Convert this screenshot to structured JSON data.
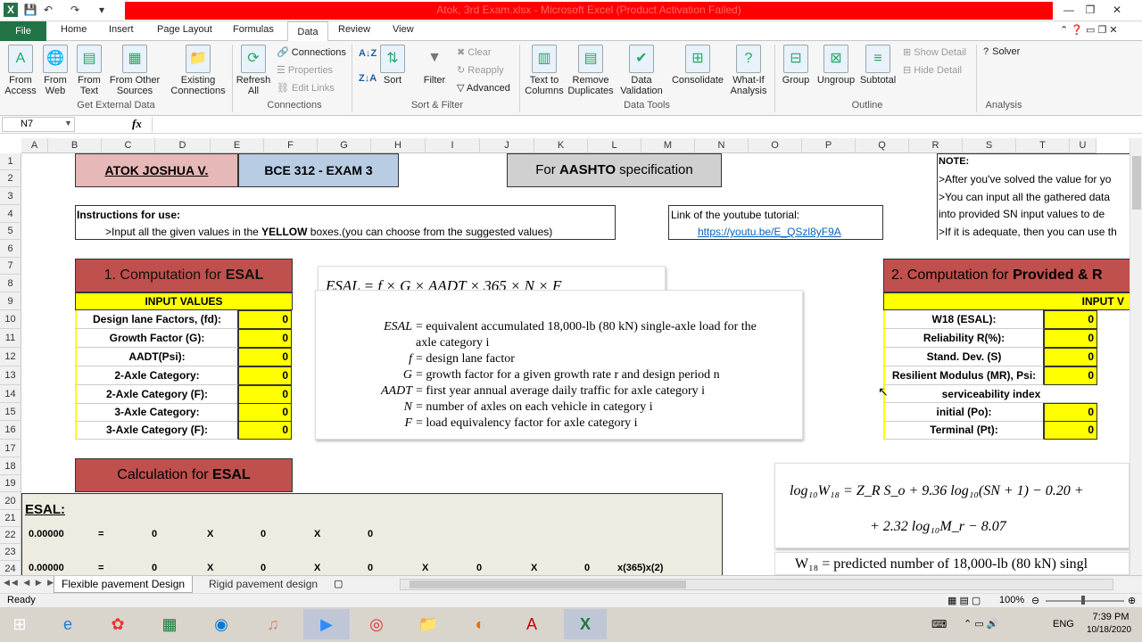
{
  "window": {
    "title": "Atok, 3rd Exam.xlsx - Microsoft Excel (Product Activation Failed)"
  },
  "menu": {
    "file": "File",
    "tabs": [
      "Home",
      "Insert",
      "Page Layout",
      "Formulas",
      "Data",
      "Review",
      "View"
    ]
  },
  "ribbon": {
    "get_external": {
      "label": "Get External Data",
      "from_access": "From Access",
      "from_web": "From Web",
      "from_text": "From Text",
      "from_other": "From Other Sources",
      "existing": "Existing Connections"
    },
    "connections": {
      "label": "Connections",
      "refresh": "Refresh All",
      "conn": "Connections",
      "props": "Properties",
      "edit": "Edit Links"
    },
    "sort_filter": {
      "label": "Sort & Filter",
      "sort": "Sort",
      "filter": "Filter",
      "clear": "Clear",
      "reapply": "Reapply",
      "advanced": "Advanced",
      "az": "A↓Z",
      "za": "Z↓A"
    },
    "data_tools": {
      "label": "Data Tools",
      "text_cols": "Text to Columns",
      "remove_dup": "Remove Duplicates",
      "validation": "Data Validation",
      "consolidate": "Consolidate",
      "whatif": "What-If Analysis"
    },
    "outline": {
      "label": "Outline",
      "group": "Group",
      "ungroup": "Ungroup",
      "subtotal": "Subtotal",
      "show_detail": "Show Detail",
      "hide_detail": "Hide Detail"
    },
    "analysis": {
      "label": "Analysis",
      "solver": "Solver"
    }
  },
  "formulabar": {
    "namebox": "N7",
    "fx": "fx",
    "value": ""
  },
  "columns": [
    "A",
    "B",
    "C",
    "D",
    "E",
    "F",
    "G",
    "H",
    "I",
    "J",
    "K",
    "L",
    "M",
    "N",
    "O",
    "P",
    "Q",
    "R",
    "S",
    "T",
    "U"
  ],
  "rows": [
    "1",
    "2",
    "3",
    "4",
    "5",
    "6",
    "7",
    "8",
    "9",
    "10",
    "11",
    "12",
    "13",
    "14",
    "15",
    "16",
    "17",
    "18",
    "19",
    "20",
    "21",
    "22",
    "23",
    "24"
  ],
  "sheet": {
    "author": "ATOK JOSHUA V.",
    "course": "BCE 312 - EXAM 3",
    "spec_pre": "For ",
    "spec_bold": "AASHTO",
    "spec_post": " specification",
    "instr_title": "Instructions for use:",
    "instr_pre": ">Input all the given values in the ",
    "instr_bold": "YELLOW",
    "instr_post": " boxes.(you can choose from the suggested values)",
    "yt_label": "Link of the youtube tutorial:",
    "yt_link": "https://youtu.be/E_QSzl8yF9A",
    "note_title": "NOTE:",
    "note_lines": [
      ">After you've solved the value for yo",
      ">You can input all the gathered data",
      " into provided SN input values to de",
      ">If it is adequate, then you can use th"
    ],
    "esal_title_pre": "1. Computation for ",
    "esal_title_bold": "ESAL",
    "input_values": "INPUT VALUES",
    "esal_inputs": [
      {
        "label": "Design lane Factors, (fd):",
        "value": "0"
      },
      {
        "label": "Growth Factor (G):",
        "value": "0"
      },
      {
        "label": "AADT(Psi):",
        "value": "0"
      },
      {
        "label": "2-Axle Category:",
        "value": "0"
      },
      {
        "label": "2-Axle Category (F):",
        "value": "0"
      },
      {
        "label": "3-Axle Category:",
        "value": "0"
      },
      {
        "label": "3-Axle Category (F):",
        "value": "0"
      }
    ],
    "esal_formula": "ESAL = f × G × AADT × 365 × N × F",
    "defs": [
      {
        "sym": "ESAL",
        "eq": "= equivalent accumulated 18,000-lb (80 kN) single-axle load for the"
      },
      {
        "sym": "",
        "eq": "axle category i"
      },
      {
        "sym": "f",
        "eq": "= design lane factor"
      },
      {
        "sym": "G",
        "eq": "= growth factor for a given growth rate r and design period n"
      },
      {
        "sym": "AADT",
        "eq": "= first year annual average daily traffic for axle category i"
      },
      {
        "sym": "N",
        "eq": "= number of axles on each vehicle in category i"
      },
      {
        "sym": "F",
        "eq": "= load equivalency factor for axle category i"
      }
    ],
    "sn_title_pre": "2. Computation for ",
    "sn_title_bold": "Provided & R",
    "sn_input": "INPUT V",
    "sn_inputs": [
      {
        "label": "W18 (ESAL):",
        "value": "0"
      },
      {
        "label": "Reliability R(%):",
        "value": "0"
      },
      {
        "label": "Stand. Dev. (S)",
        "value": "0"
      },
      {
        "label": "Resilient Modulus (MR), Psi:",
        "value": "0"
      }
    ],
    "serviceability": "serviceability index",
    "sn_inputs2": [
      {
        "label": "initial (Po):",
        "value": "0"
      },
      {
        "label": "Terminal (Pt):",
        "value": "0"
      }
    ],
    "calc_title_pre": "Calculation for ",
    "calc_title_bold": "ESAL",
    "esal_label": "ESAL:",
    "row22": [
      "0.00000",
      "=",
      "0",
      "X",
      "0",
      "X",
      "0"
    ],
    "row24": [
      "0.00000",
      "=",
      "0",
      "X",
      "0",
      "X",
      "0",
      "X",
      "0",
      "X",
      "0",
      "x(365)x(2)"
    ],
    "log_line1": "log₁₀W₁₈ = Z_R S_o + 9.36 log₁₀(SN + 1) − 0.20 +",
    "log_line2": "+ 2.32 log₁₀M_r − 8.07",
    "w18_def": "W₁₈ = predicted number of 18,000-lb (80 kN) singl"
  },
  "tabs": {
    "sheet1": "Flexible pavement Design",
    "sheet2": "Rigid pavement design"
  },
  "status": {
    "ready": "Ready",
    "zoom": "100%"
  },
  "taskbar": {
    "lang": "ENG",
    "time": "7:39 PM",
    "date": "10/18/2020"
  }
}
